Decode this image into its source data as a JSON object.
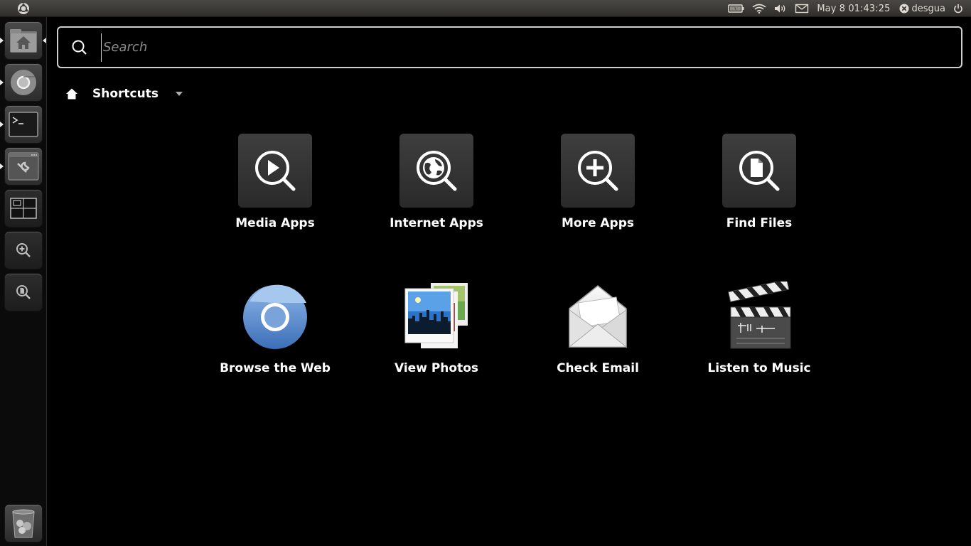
{
  "panel": {
    "clock": "May 8 01:43:25",
    "username": "desgua"
  },
  "search": {
    "placeholder": "Search",
    "value": ""
  },
  "filter": {
    "label": "Shortcuts"
  },
  "shortcut_tiles": [
    {
      "label": "Media Apps",
      "icon": "media-apps-icon"
    },
    {
      "label": "Internet Apps",
      "icon": "internet-apps-icon"
    },
    {
      "label": "More Apps",
      "icon": "more-apps-icon"
    },
    {
      "label": "Find Files",
      "icon": "find-files-icon"
    }
  ],
  "app_tiles": [
    {
      "label": "Browse the Web",
      "icon": "chromium-icon"
    },
    {
      "label": "View Photos",
      "icon": "photos-icon"
    },
    {
      "label": "Check Email",
      "icon": "email-icon"
    },
    {
      "label": "Listen to Music",
      "icon": "music-clapboard-icon"
    }
  ],
  "launcher": {
    "items": [
      "home-folder-icon",
      "chromium-icon",
      "terminal-icon",
      "system-settings-icon",
      "workspace-switcher-icon",
      "applications-lens-icon",
      "files-lens-icon",
      "trash-icon"
    ]
  },
  "colors": {
    "panel_bg": "#3a3935",
    "dash_bg": "#000000",
    "tile_bg": "#333333",
    "search_border": "#cfcfcf"
  }
}
